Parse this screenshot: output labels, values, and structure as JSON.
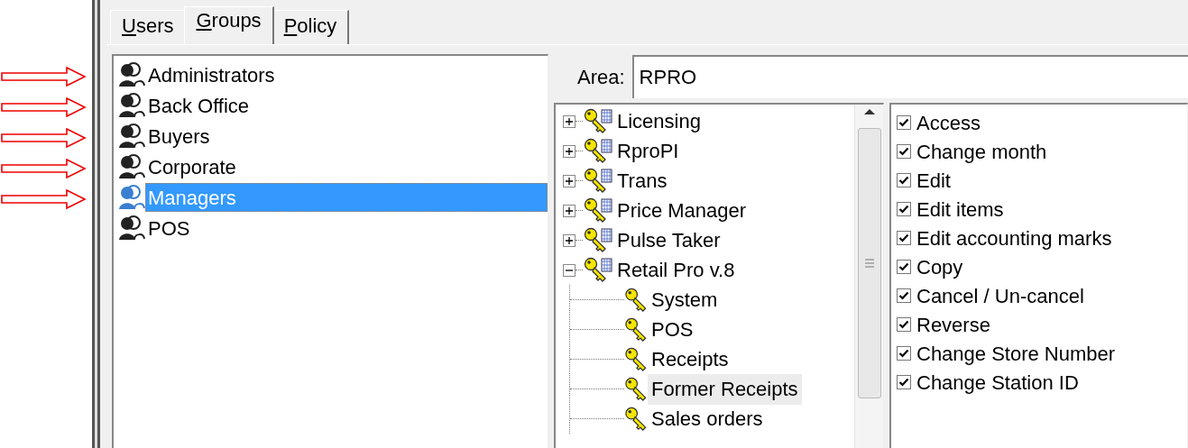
{
  "tabs": [
    {
      "label": "Users",
      "selected": false
    },
    {
      "label": "Groups",
      "selected": true
    },
    {
      "label": "Policy",
      "selected": false
    }
  ],
  "groups": [
    {
      "name": "Administrators",
      "selected": false,
      "marked": true
    },
    {
      "name": "Back Office",
      "selected": false,
      "marked": true
    },
    {
      "name": "Buyers",
      "selected": false,
      "marked": true
    },
    {
      "name": "Corporate",
      "selected": false,
      "marked": true
    },
    {
      "name": "Managers",
      "selected": true,
      "marked": true
    },
    {
      "name": "POS",
      "selected": false,
      "marked": false
    }
  ],
  "area": {
    "label": "Area:",
    "value": "RPRO"
  },
  "tree": [
    {
      "label": "Licensing",
      "expanded": false,
      "selected": false
    },
    {
      "label": "RproPI",
      "expanded": false,
      "selected": false
    },
    {
      "label": "Trans",
      "expanded": false,
      "selected": false
    },
    {
      "label": "Price Manager",
      "expanded": false,
      "selected": false
    },
    {
      "label": "Pulse Taker",
      "expanded": false,
      "selected": false
    },
    {
      "label": "Retail Pro v.8",
      "expanded": true,
      "selected": false,
      "children": [
        {
          "label": "System",
          "selected": false
        },
        {
          "label": "POS",
          "selected": false
        },
        {
          "label": "Receipts",
          "selected": false
        },
        {
          "label": "Former Receipts",
          "selected": true
        },
        {
          "label": "Sales orders",
          "selected": false
        }
      ]
    }
  ],
  "permissions": [
    {
      "label": "Access",
      "checked": true
    },
    {
      "label": "Change month",
      "checked": true
    },
    {
      "label": "Edit",
      "checked": true
    },
    {
      "label": "Edit items",
      "checked": true
    },
    {
      "label": "Edit accounting marks",
      "checked": true
    },
    {
      "label": "Copy",
      "checked": true
    },
    {
      "label": "Cancel / Un-cancel",
      "checked": true
    },
    {
      "label": "Reverse",
      "checked": true
    },
    {
      "label": "Change Store Number",
      "checked": true
    },
    {
      "label": "Change Station ID",
      "checked": true
    }
  ]
}
